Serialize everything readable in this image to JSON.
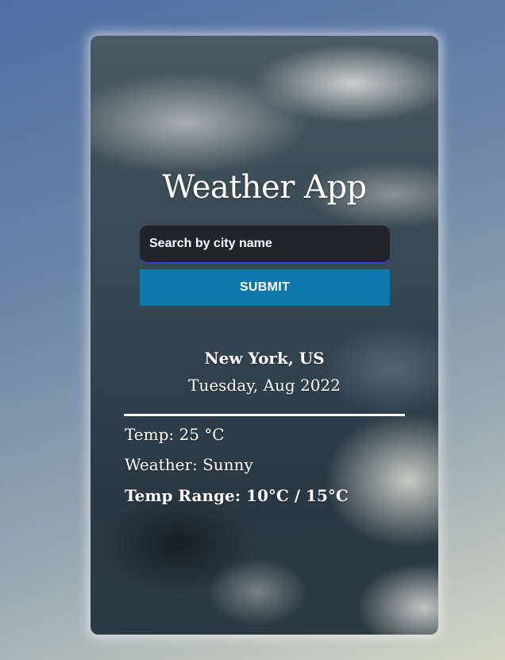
{
  "app": {
    "title": "Weather App"
  },
  "search": {
    "placeholder": "Search by city name",
    "submit_label": "SUBMIT"
  },
  "result": {
    "location": "New York, US",
    "date": "Tuesday, Aug 2022",
    "temp": "Temp: 25 °C",
    "weather": "Weather: Sunny",
    "temp_range": "Temp Range: 10°C / 15°C"
  },
  "colors": {
    "submit_button": "#0d78ab",
    "input_underline": "#2f3fd0",
    "input_background": "#1e2024",
    "text": "#ffffff"
  }
}
